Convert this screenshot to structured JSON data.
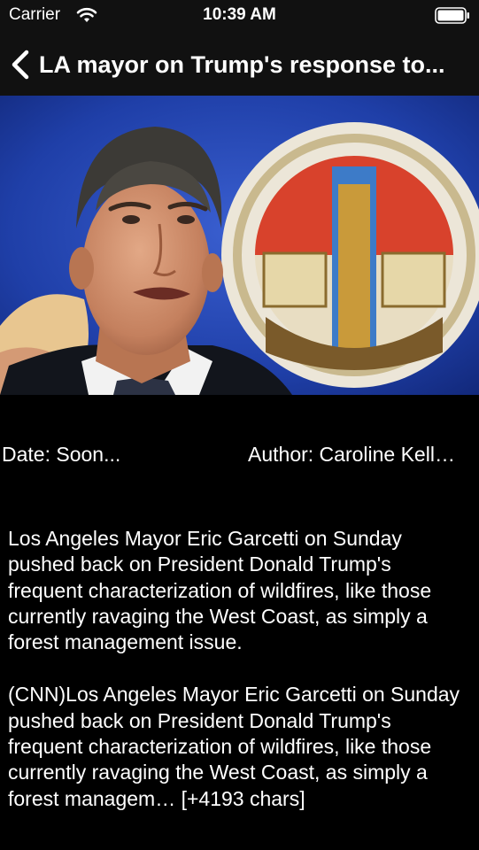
{
  "status_bar": {
    "carrier": "Carrier",
    "time": "10:39 AM"
  },
  "nav": {
    "title": "LA mayor on Trump's response to..."
  },
  "hero_image": {
    "subject": "Los Angeles Mayor Eric Garcetti speaking in front of the City of Los Angeles seal"
  },
  "meta": {
    "date": "Date: Soon...",
    "author": "Author: Caroline Kell…"
  },
  "article": {
    "description": "Los Angeles Mayor Eric Garcetti on Sunday pushed back on President Donald Trump's frequent characterization of wildfires, like those currently ravaging the West Coast, as simply a forest management issue.",
    "content": "(CNN)Los Angeles Mayor Eric Garcetti on Sunday pushed back on President Donald Trump's frequent characterization of wildfires, like those currently ravaging the West Coast, as simply a forest managem… [+4193 chars]"
  },
  "colors": {
    "background": "#000000",
    "bars": "#111111",
    "text": "#ffffff"
  }
}
